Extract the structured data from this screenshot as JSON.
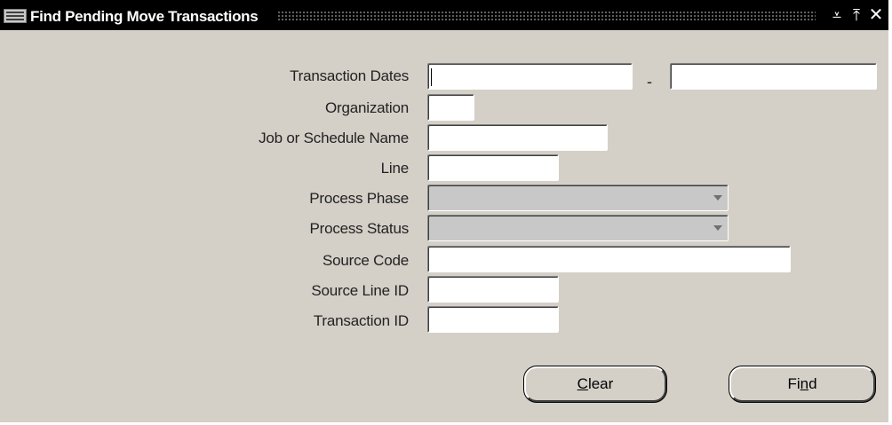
{
  "window": {
    "title": "Find Pending Move Transactions",
    "controls": {
      "minimize_icon": "minimize-icon",
      "maximize_icon": "maximize-icon",
      "close_icon": "close-icon"
    }
  },
  "form": {
    "transaction_dates_label": "Transaction Dates",
    "transaction_dates_from": "",
    "transaction_dates_separator": "-",
    "transaction_dates_to": "",
    "organization_label": "Organization",
    "organization_value": "",
    "job_label": "Job or Schedule Name",
    "job_value": "",
    "line_label": "Line",
    "line_value": "",
    "process_phase_label": "Process Phase",
    "process_phase_value": "",
    "process_status_label": "Process Status",
    "process_status_value": "",
    "source_code_label": "Source Code",
    "source_code_value": "",
    "source_line_id_label": "Source Line ID",
    "source_line_id_value": "",
    "transaction_id_label": "Transaction ID",
    "transaction_id_value": ""
  },
  "buttons": {
    "clear_mnemonic": "C",
    "clear_rest": "lear",
    "find_pre": "Fi",
    "find_mnemonic": "n",
    "find_post": "d"
  },
  "colors": {
    "window_bg": "#d4d0c8",
    "titlebar_bg": "#000000",
    "field_bg": "#ffffff",
    "disabled_select_bg": "#c8c8c8"
  }
}
